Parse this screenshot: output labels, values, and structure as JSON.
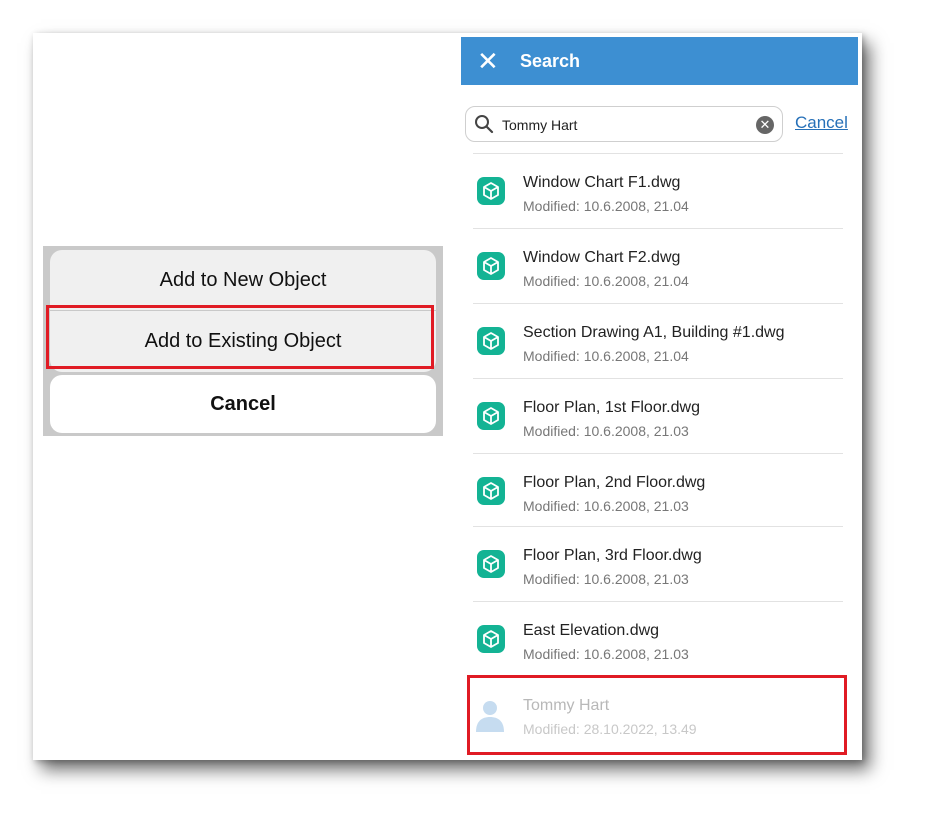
{
  "action_sheet": {
    "add_new_label": "Add to New Object",
    "add_existing_label": "Add to Existing Object",
    "cancel_label": "Cancel"
  },
  "search_panel": {
    "title": "Search",
    "query": "Tommy Hart",
    "cancel_label": "Cancel",
    "results": [
      {
        "name": "Window Chart F1.dwg",
        "modified": "Modified: 10.6.2008, 21.04",
        "icon": "cube-file-icon"
      },
      {
        "name": "Window Chart F2.dwg",
        "modified": "Modified: 10.6.2008, 21.04",
        "icon": "cube-file-icon"
      },
      {
        "name": "Section Drawing A1, Building #1.dwg",
        "modified": "Modified: 10.6.2008, 21.04",
        "icon": "cube-file-icon"
      },
      {
        "name": "Floor Plan, 1st Floor.dwg",
        "modified": "Modified: 10.6.2008, 21.03",
        "icon": "cube-file-icon"
      },
      {
        "name": "Floor Plan, 2nd Floor.dwg",
        "modified": "Modified: 10.6.2008, 21.03",
        "icon": "cube-file-icon"
      },
      {
        "name": "Floor Plan, 3rd Floor.dwg",
        "modified": "Modified: 10.6.2008, 21.03",
        "icon": "cube-file-icon"
      },
      {
        "name": "East Elevation.dwg",
        "modified": "Modified: 10.6.2008, 21.03",
        "icon": "cube-file-icon"
      },
      {
        "name": "Tommy Hart",
        "modified": "Modified: 28.10.2022, 13.49",
        "icon": "person-icon"
      }
    ]
  },
  "colors": {
    "topbar": "#3d8fd2",
    "file_icon": "#13b394",
    "highlight": "#e01b24",
    "link": "#2670b8"
  }
}
